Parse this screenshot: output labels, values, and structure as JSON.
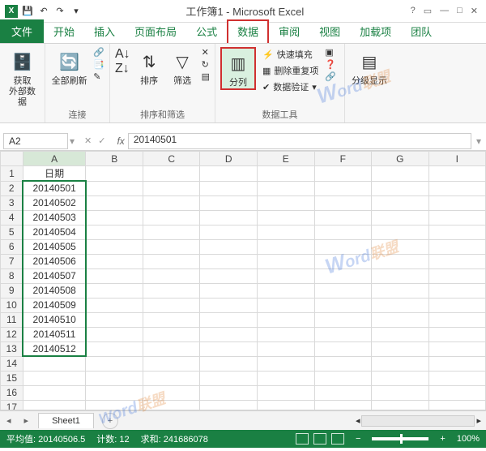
{
  "title": "工作簿1 - Microsoft Excel",
  "qat": {
    "undo": "↶",
    "redo": "↷"
  },
  "tabs": {
    "file": "文件",
    "items": [
      "开始",
      "插入",
      "页面布局",
      "公式",
      "数据",
      "审阅",
      "视图",
      "加载项",
      "团队"
    ],
    "activeIndex": 4
  },
  "ribbon": {
    "g1": {
      "btn": "获取\n外部数据",
      "label": ""
    },
    "g2": {
      "btn": "全部刷新",
      "label": "连接"
    },
    "g3": {
      "sort": "排序",
      "filter": "筛选",
      "label": "排序和筛选"
    },
    "g4": {
      "textcol": "分列",
      "flashfill": "快速填充",
      "dedupe": "删除重复项",
      "validation": "数据验证",
      "label": "数据工具"
    },
    "g5": {
      "btn": "分级显示"
    }
  },
  "namebox": "A2",
  "formula": "20140501",
  "columns": [
    "A",
    "B",
    "C",
    "D",
    "E",
    "F",
    "G",
    "I"
  ],
  "rows": [
    {
      "r": 1,
      "a": "日期"
    },
    {
      "r": 2,
      "a": "20140501"
    },
    {
      "r": 3,
      "a": "20140502"
    },
    {
      "r": 4,
      "a": "20140503"
    },
    {
      "r": 5,
      "a": "20140504"
    },
    {
      "r": 6,
      "a": "20140505"
    },
    {
      "r": 7,
      "a": "20140506"
    },
    {
      "r": 8,
      "a": "20140507"
    },
    {
      "r": 9,
      "a": "20140508"
    },
    {
      "r": 10,
      "a": "20140509"
    },
    {
      "r": 11,
      "a": "20140510"
    },
    {
      "r": 12,
      "a": "20140511"
    },
    {
      "r": 13,
      "a": "20140512"
    },
    {
      "r": 14,
      "a": ""
    },
    {
      "r": 15,
      "a": ""
    },
    {
      "r": 16,
      "a": ""
    },
    {
      "r": 17,
      "a": ""
    }
  ],
  "sheetTab": "Sheet1",
  "status": {
    "avg_label": "平均值:",
    "avg": "20140506.5",
    "count_label": "计数:",
    "count": "12",
    "sum_label": "求和:",
    "sum": "241686078",
    "zoom": "100%"
  },
  "watermark": {
    "w": "W",
    "rest": "ord",
    "cn": "联盟"
  }
}
